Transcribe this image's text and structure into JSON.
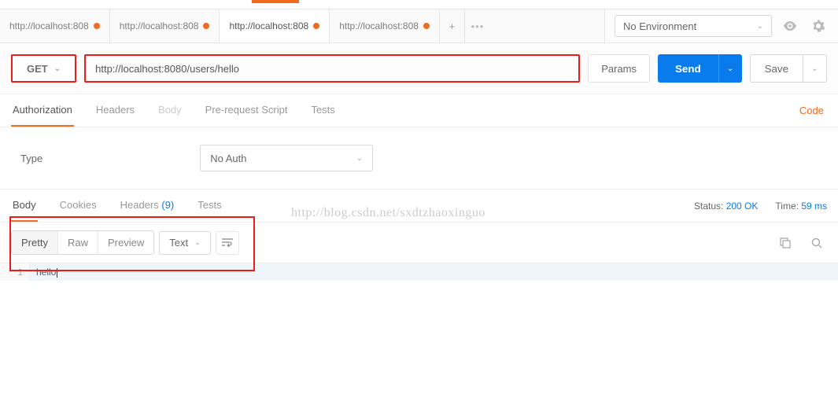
{
  "env": {
    "selected": "No Environment"
  },
  "tabs": [
    {
      "label": "http://localhost:808"
    },
    {
      "label": "http://localhost:808"
    },
    {
      "label": "http://localhost:808"
    },
    {
      "label": "http://localhost:808"
    }
  ],
  "activeTabIndex": 2,
  "request": {
    "method": "GET",
    "url": "http://localhost:8080/users/hello",
    "paramsBtn": "Params",
    "sendBtn": "Send",
    "saveBtn": "Save"
  },
  "requestTabs": {
    "items": [
      "Authorization",
      "Headers",
      "Body",
      "Pre-request Script",
      "Tests"
    ],
    "active": 0,
    "codeLink": "Code"
  },
  "auth": {
    "typeLabel": "Type",
    "selected": "No Auth"
  },
  "responseTabs": {
    "items": [
      "Body",
      "Cookies",
      "Headers",
      "Tests"
    ],
    "headersCount": "(9)",
    "active": 0,
    "status": {
      "label": "Status:",
      "value": "200 OK"
    },
    "time": {
      "label": "Time:",
      "value": "59 ms"
    }
  },
  "view": {
    "modes": [
      "Pretty",
      "Raw",
      "Preview"
    ],
    "activeMode": 0,
    "format": "Text"
  },
  "responseBody": {
    "lines": [
      {
        "num": "1",
        "text": "hello"
      }
    ]
  },
  "watermark": "http://blog.csdn.net/sxdtzhaoxinguo"
}
